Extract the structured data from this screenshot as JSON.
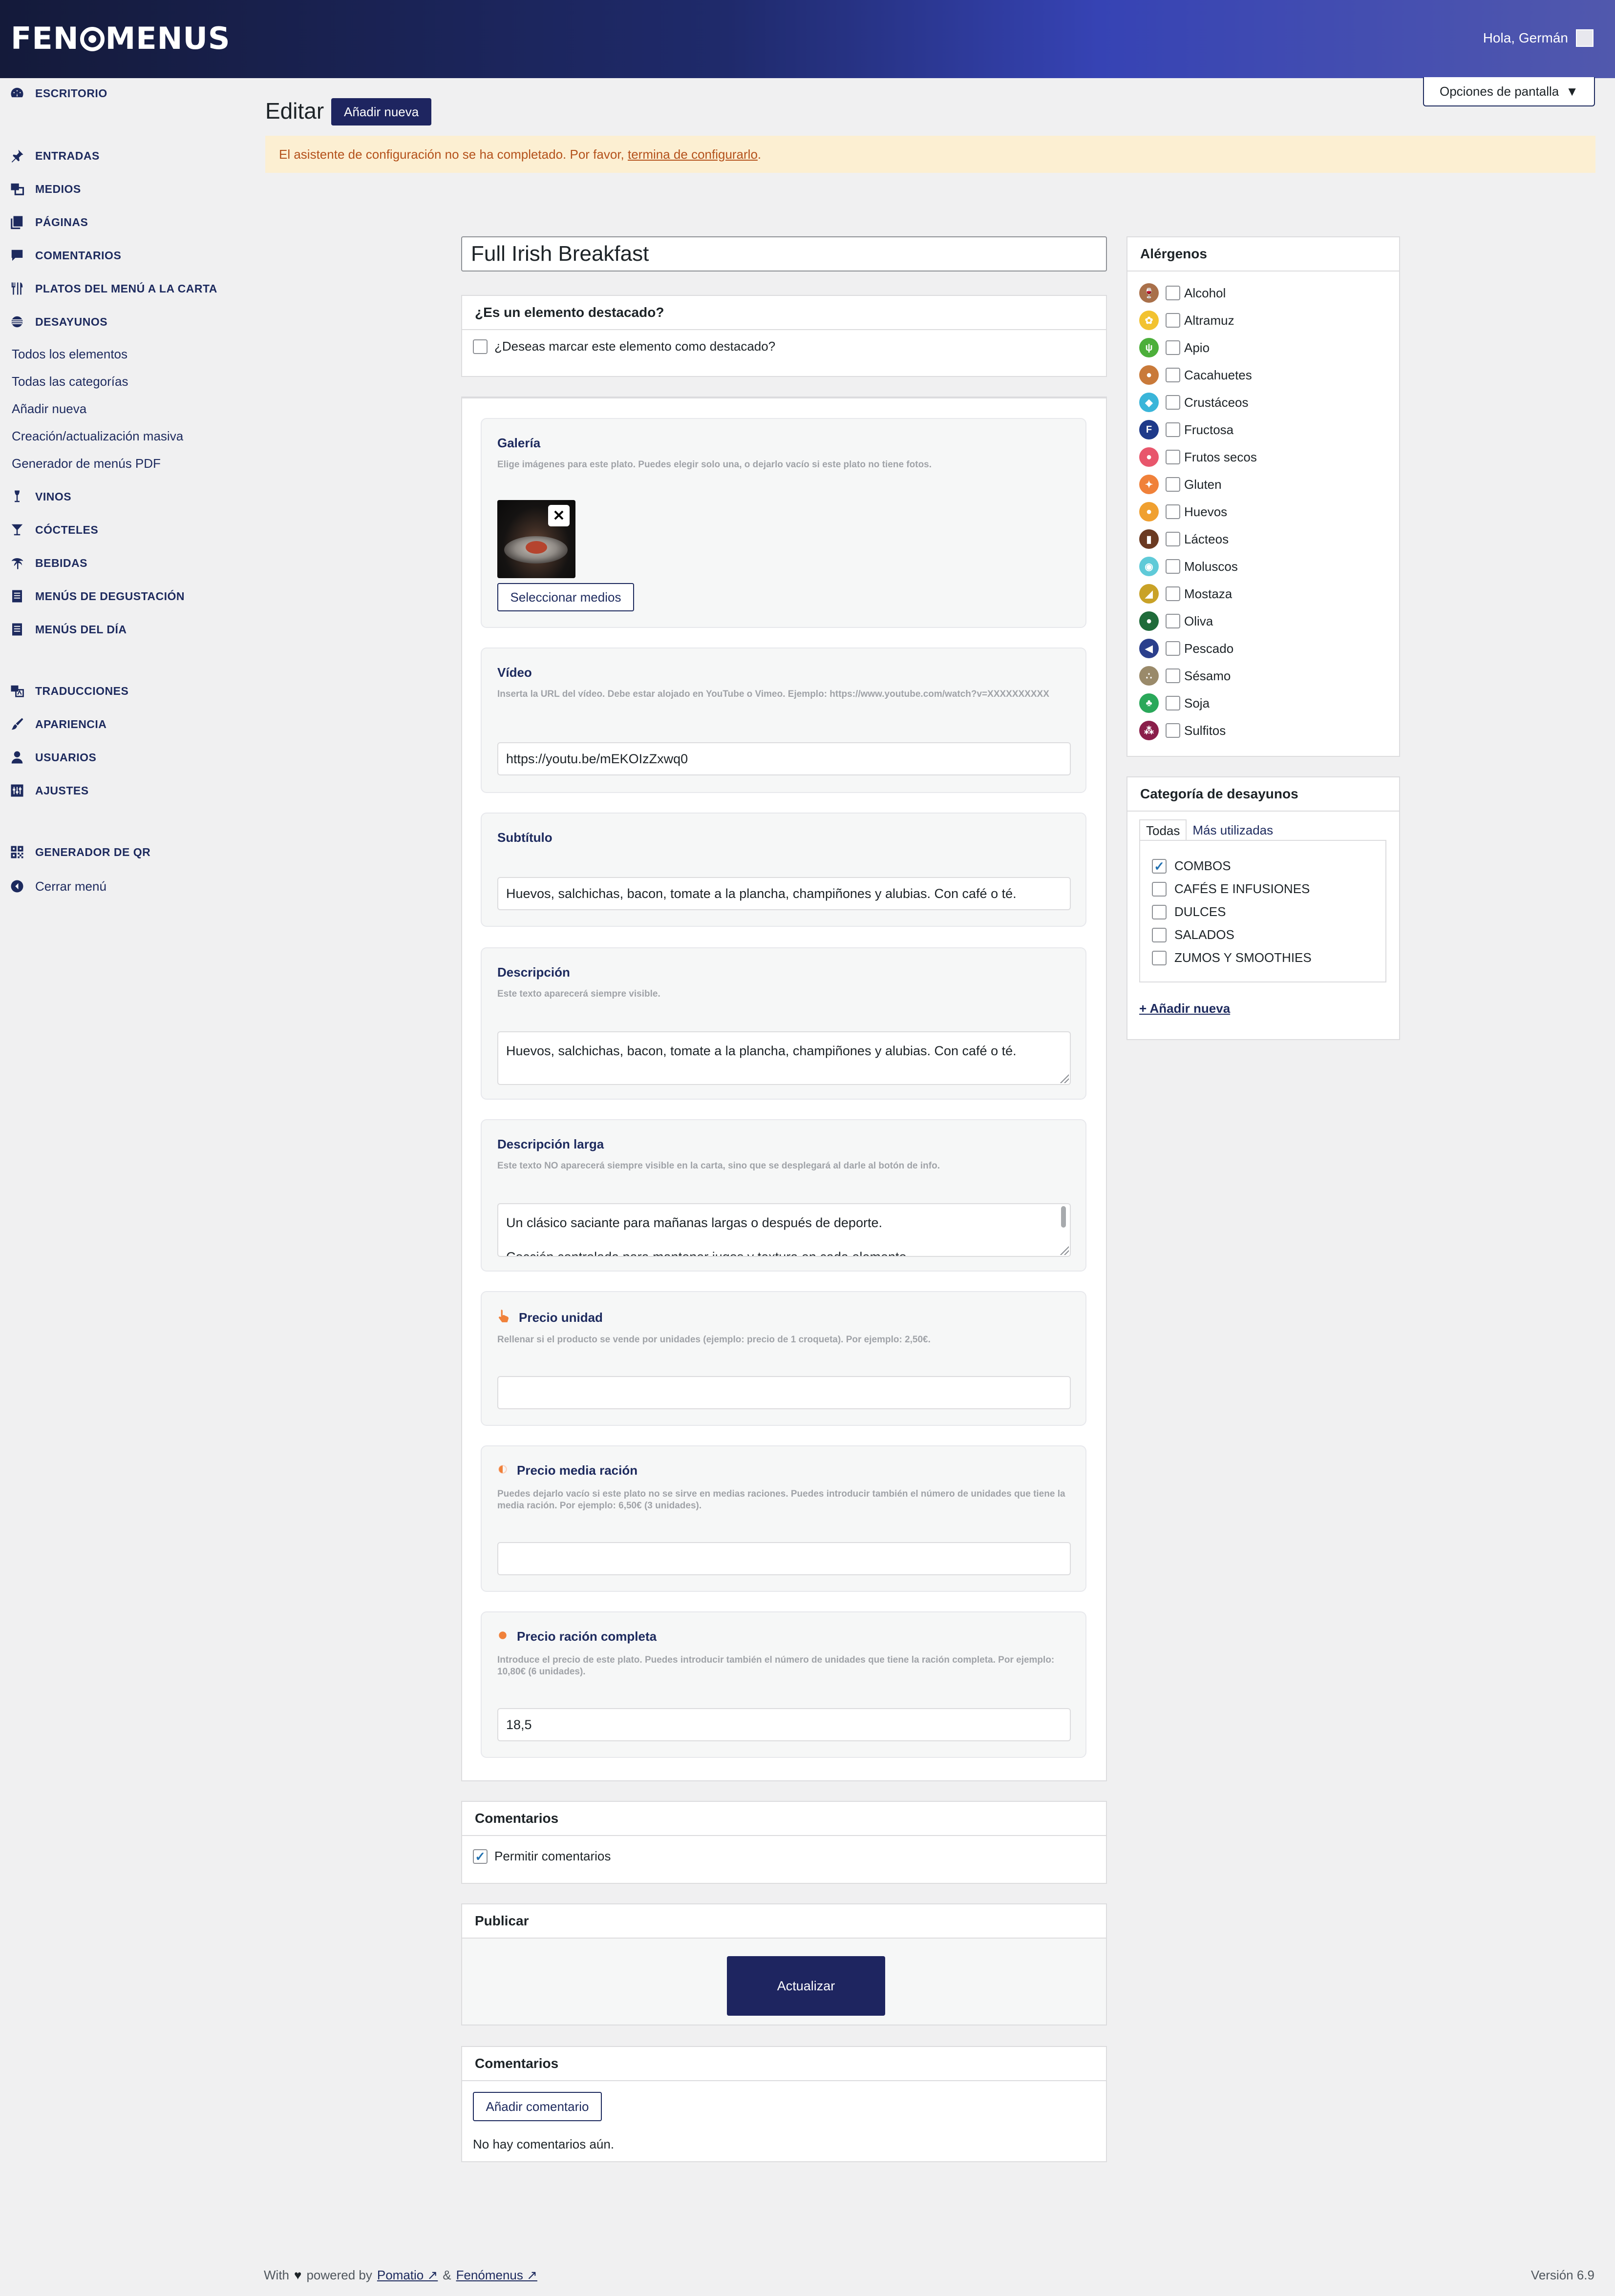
{
  "app": {
    "logo_text_left": "FEN",
    "logo_text_right": "MENUS",
    "greeting": "Hola, Germán"
  },
  "sidebar": {
    "items": [
      {
        "label": "ESCRITORIO",
        "icon": "dashboard-icon"
      },
      {
        "label": "ENTRADAS",
        "icon": "pin-icon"
      },
      {
        "label": "MEDIOS",
        "icon": "media-icon"
      },
      {
        "label": "PÁGINAS",
        "icon": "pages-icon"
      },
      {
        "label": "COMENTARIOS",
        "icon": "comment-icon"
      },
      {
        "label": "PLATOS DEL MENÚ A LA CARTA",
        "icon": "cutlery-icon"
      },
      {
        "label": "DESAYUNOS",
        "icon": "sun-icon"
      },
      {
        "label": "VINOS",
        "icon": "wine-icon"
      },
      {
        "label": "CÓCTELES",
        "icon": "cocktail-icon"
      },
      {
        "label": "BEBIDAS",
        "icon": "palm-icon"
      },
      {
        "label": "MENÚS DE DEGUSTACIÓN",
        "icon": "document-icon"
      },
      {
        "label": "MENÚS DEL DÍA",
        "icon": "document-icon"
      },
      {
        "label": "TRADUCCIONES",
        "icon": "translate-icon"
      },
      {
        "label": "APARIENCIA",
        "icon": "brush-icon"
      },
      {
        "label": "USUARIOS",
        "icon": "user-icon"
      },
      {
        "label": "AJUSTES",
        "icon": "settings-icon"
      },
      {
        "label": "GENERADOR DE QR",
        "icon": "qr-icon"
      }
    ],
    "subitems": [
      "Todos los elementos",
      "Todas las categorías",
      "Añadir nueva",
      "Creación/actualización masiva",
      "Generador de menús PDF"
    ],
    "close_label": "Cerrar menú"
  },
  "header": {
    "title": "Editar",
    "add_new": "Añadir nueva",
    "screen_options": "Opciones de pantalla",
    "notice_text": "El asistente de configuración no se ha completado. Por favor, ",
    "notice_link": "termina de configurarlo",
    "notice_end": "."
  },
  "post": {
    "title": "Full Irish Breakfast",
    "featured": {
      "heading": "¿Es un elemento destacado?",
      "checkbox_label": "¿Deseas marcar este elemento como destacado?",
      "checked": false
    },
    "gallery": {
      "label": "Galería",
      "help": "Elige imágenes para este plato. Puedes elegir solo una, o dejarlo vacío si este plato no tiene fotos.",
      "select_button": "Seleccionar medios",
      "remove_icon": "✕"
    },
    "video": {
      "label": "Vídeo",
      "help": "Inserta la URL del vídeo. Debe estar alojado en YouTube o Vimeo. Ejemplo: https://www.youtube.com/watch?v=XXXXXXXXXX",
      "value": "https://youtu.be/mEKOIzZxwq0"
    },
    "subtitle": {
      "label": "Subtítulo",
      "value": "Huevos, salchichas, bacon, tomate a la plancha, champiñones y alubias. Con café o té."
    },
    "description": {
      "label": "Descripción",
      "help": "Este texto aparecerá siempre visible.",
      "value": "Huevos, salchichas, bacon, tomate a la plancha, champiñones y alubias. Con café o té."
    },
    "long_description": {
      "label": "Descripción larga",
      "help": "Este texto NO aparecerá siempre visible en la carta, sino que se desplegará al darle al botón de info.",
      "line1": "Un clásico saciante para mañanas largas o después de deporte.",
      "line2": "Cocción controlada para mantener jugos y textura en cada elemento."
    },
    "unit_price": {
      "label": "Precio unidad",
      "help": "Rellenar si el producto se vende por unidades (ejemplo: precio de 1 croqueta). Por ejemplo: 2,50€.",
      "value": ""
    },
    "half_price": {
      "label": "Precio media ración",
      "help": "Puedes dejarlo vacío si este plato no se sirve en medias raciones. Puedes introducir también el número de unidades que tiene la media ración. Por ejemplo: 6,50€ (3 unidades).",
      "value": ""
    },
    "full_price": {
      "label": "Precio ración completa",
      "help": "Introduce el precio de este plato. Puedes introducir también el número de unidades que tiene la ración completa. Por ejemplo: 10,80€ (6 unidades).",
      "value": "18,5"
    }
  },
  "discussion": {
    "heading": "Comentarios",
    "allow_label": "Permitir comentarios",
    "checked": true
  },
  "publish": {
    "heading": "Publicar",
    "update_button": "Actualizar"
  },
  "comments": {
    "heading": "Comentarios",
    "add_button": "Añadir comentario",
    "empty_text": "No hay comentarios aún."
  },
  "allergens": {
    "heading": "Alérgenos",
    "items": [
      {
        "name": "Alcohol",
        "color": "#a9704a"
      },
      {
        "name": "Altramuz",
        "color": "#f2c230"
      },
      {
        "name": "Apio",
        "color": "#4caf3a"
      },
      {
        "name": "Cacahuetes",
        "color": "#c97a3a"
      },
      {
        "name": "Crustáceos",
        "color": "#3ab5d9"
      },
      {
        "name": "Fructosa",
        "color": "#1e3a8a"
      },
      {
        "name": "Frutos secos",
        "color": "#e8566c"
      },
      {
        "name": "Gluten",
        "color": "#f0813a"
      },
      {
        "name": "Huevos",
        "color": "#f0a030"
      },
      {
        "name": "Lácteos",
        "color": "#6b3a22"
      },
      {
        "name": "Moluscos",
        "color": "#5fcad8"
      },
      {
        "name": "Mostaza",
        "color": "#c9a227"
      },
      {
        "name": "Oliva",
        "color": "#1f6b3a"
      },
      {
        "name": "Pescado",
        "color": "#2b3f8c"
      },
      {
        "name": "Sésamo",
        "color": "#9a8a6a"
      },
      {
        "name": "Soja",
        "color": "#2aa85a"
      },
      {
        "name": "Sulfitos",
        "color": "#8a1e4a"
      }
    ]
  },
  "category": {
    "heading": "Categoría de desayunos",
    "tabs": [
      "Todas",
      "Más utilizadas"
    ],
    "items": [
      {
        "label": "COMBOS",
        "checked": true
      },
      {
        "label": "CAFÉS E INFUSIONES",
        "checked": false
      },
      {
        "label": "DULCES",
        "checked": false
      },
      {
        "label": "SALADOS",
        "checked": false
      },
      {
        "label": "ZUMOS Y SMOOTHIES",
        "checked": false
      }
    ],
    "add_link": "+ Añadir nueva"
  },
  "footer": {
    "with": "With",
    "powered": "powered by",
    "link1": "Pomatio ↗",
    "amp": "&",
    "link2": "Fenómenus ↗",
    "version": "Versión 6.9"
  },
  "colors": {
    "accent": "#1e2560",
    "notice_bg": "#fcefd2",
    "notice_text": "#b4511b"
  }
}
